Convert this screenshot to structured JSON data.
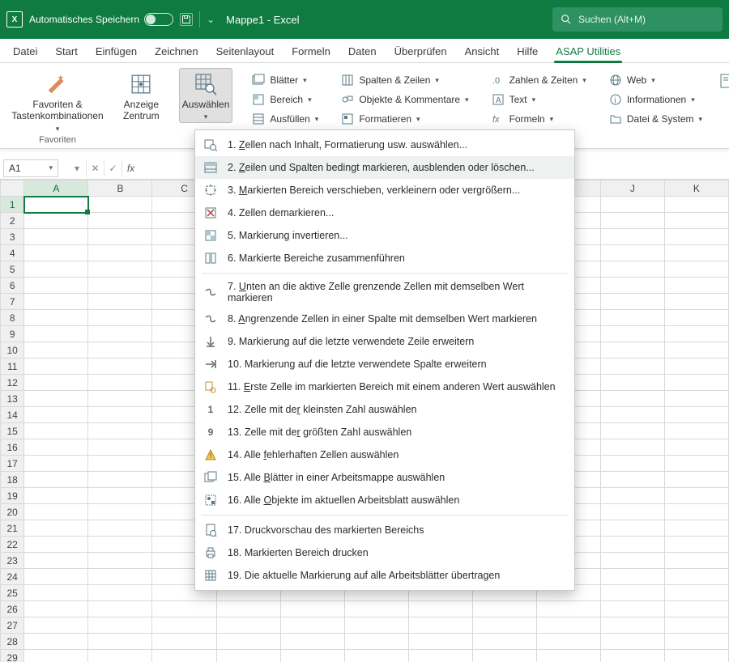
{
  "titlebar": {
    "autosave_label": "Automatisches Speichern",
    "doc_title": "Mappe1  -  Excel",
    "down_glyph": "⌄",
    "search_placeholder": "Suchen (Alt+M)"
  },
  "tabs": {
    "items": [
      "Datei",
      "Start",
      "Einfügen",
      "Zeichnen",
      "Seitenlayout",
      "Formeln",
      "Daten",
      "Überprüfen",
      "Ansicht",
      "Hilfe",
      "ASAP Utilities"
    ],
    "active_index": 10
  },
  "ribbon": {
    "favorites_group_label": "Favoriten",
    "favorites_big_label_line1": "Favoriten &",
    "favorites_big_label_line2": "Tastenkombinationen",
    "anzeige_line1": "Anzeige",
    "anzeige_line2": "Zentrum",
    "auswahlen": "Auswählen",
    "col1": {
      "a": "Blätter",
      "b": "Bereich",
      "c": "Ausfüllen"
    },
    "col2": {
      "a": "Spalten & Zeilen",
      "b": "Objekte & Kommentare",
      "c": "Formatieren"
    },
    "col3": {
      "a": "Zahlen & Zeiten",
      "b": "Text",
      "c": "Formeln"
    },
    "col4": {
      "a": "Web",
      "b": "Informationen",
      "c": "Datei & System"
    }
  },
  "fx": {
    "namebox": "A1",
    "fx_label": "fx"
  },
  "grid": {
    "cols": [
      "A",
      "B",
      "C",
      "D",
      "E",
      "F",
      "G",
      "H",
      "I",
      "J",
      "K"
    ],
    "rows": 29
  },
  "menu": {
    "items": [
      {
        "n": "1.",
        "t": "Zellen nach Inhalt, Formatierung usw. auswählen...",
        "u": 0
      },
      {
        "n": "2.",
        "t": "Zeilen und Spalten bedingt markieren, ausblenden oder löschen...",
        "u": 0,
        "hover": true
      },
      {
        "n": "3.",
        "t": "Markierten Bereich verschieben, verkleinern oder vergrößern...",
        "u": 0
      },
      {
        "n": "4.",
        "t": "Zellen demarkieren...",
        "u": -1
      },
      {
        "n": "5.",
        "t": "Markierung invertieren...",
        "u": -1
      },
      {
        "n": "6.",
        "t": "Markierte Bereiche zusammenführen",
        "u": -1
      },
      {
        "n": "7.",
        "t": "Unten an die aktive Zelle grenzende Zellen mit demselben Wert markieren",
        "u": 0
      },
      {
        "n": "8.",
        "t": "Angrenzende Zellen in einer Spalte mit demselben Wert markieren",
        "u": 0
      },
      {
        "n": "9.",
        "t": "Markierung auf die letzte verwendete Zeile erweitern",
        "u": -1
      },
      {
        "n": "10.",
        "t": "Markierung auf die letzte verwendete Spalte erweitern",
        "u": -1
      },
      {
        "n": "11.",
        "t": "Erste Zelle im markierten Bereich mit einem anderen Wert auswählen",
        "u": 0
      },
      {
        "n": "12.",
        "t": "Zelle mit der kleinsten Zahl auswählen",
        "u": 12,
        "icontext": "1"
      },
      {
        "n": "13.",
        "t": "Zelle mit der größten Zahl auswählen",
        "u": 12,
        "icontext": "9"
      },
      {
        "n": "14.",
        "t": "Alle fehlerhaften Zellen auswählen",
        "u": 5
      },
      {
        "n": "15.",
        "t": "Alle Blätter in einer Arbeitsmappe auswählen",
        "u": 5
      },
      {
        "n": "16.",
        "t": "Alle Objekte im aktuellen Arbeitsblatt auswählen",
        "u": 5
      },
      {
        "n": "17.",
        "t": "Druckvorschau des markierten Bereichs",
        "u": -1
      },
      {
        "n": "18.",
        "t": "Markierten Bereich drucken",
        "u": -1
      },
      {
        "n": "19.",
        "t": "Die aktuelle Markierung auf alle Arbeitsblätter übertragen",
        "u": -1
      }
    ],
    "sep_after": [
      5,
      15
    ]
  }
}
